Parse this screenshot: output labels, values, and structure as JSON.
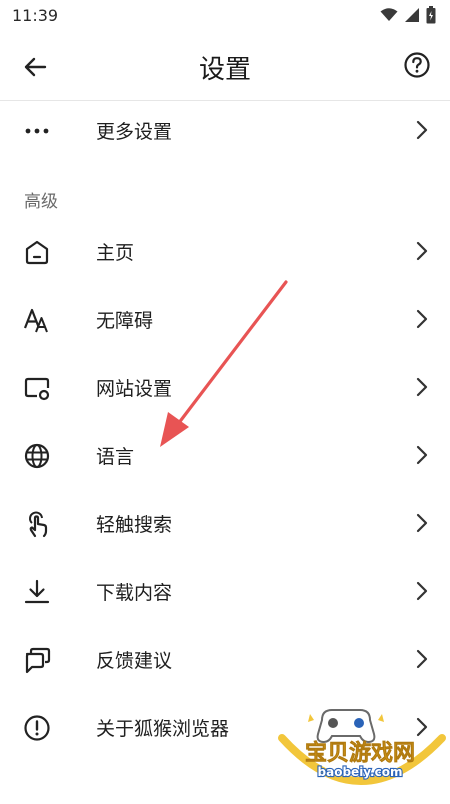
{
  "status": {
    "time": "11:39"
  },
  "header": {
    "title": "设置",
    "back_icon": "arrow-left-icon",
    "help_icon": "help-circle-icon"
  },
  "items": [
    {
      "icon": "more-dots-icon",
      "label": "更多设置"
    },
    {
      "icon": "home-icon",
      "label": "主页"
    },
    {
      "icon": "text-size-icon",
      "label": "无障碍"
    },
    {
      "icon": "site-settings-icon",
      "label": "网站设置"
    },
    {
      "icon": "globe-icon",
      "label": "语言"
    },
    {
      "icon": "touch-icon",
      "label": "轻触搜索"
    },
    {
      "icon": "download-icon",
      "label": "下载内容"
    },
    {
      "icon": "feedback-icon",
      "label": "反馈建议"
    },
    {
      "icon": "info-icon",
      "label": "关于狐猴浏览器"
    }
  ],
  "section": {
    "advanced": "高级"
  },
  "annotation": {
    "color": "#e85454",
    "points_to": "语言"
  },
  "watermark": {
    "title": "宝贝游戏网",
    "url": "baobeiy.com"
  }
}
